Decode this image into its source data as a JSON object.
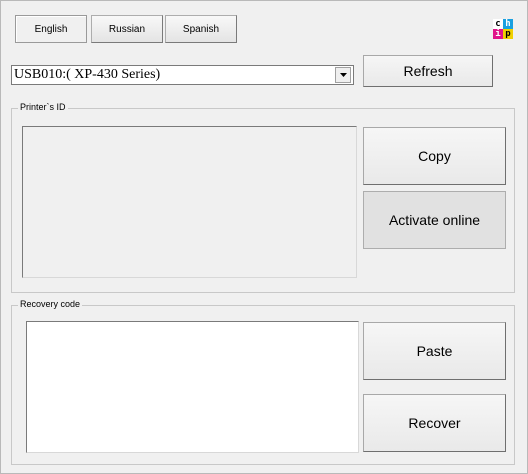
{
  "languages": [
    {
      "label": "English",
      "active": true
    },
    {
      "label": "Russian",
      "active": false
    },
    {
      "label": "Spanish",
      "active": false
    }
  ],
  "logo": {
    "letters": [
      "c",
      "h",
      "i",
      "p"
    ],
    "colors": [
      "#000000",
      "#1aa0e0",
      "#e0148a",
      "#f0d000"
    ]
  },
  "printer_select": {
    "value": "USB010:( XP-430 Series)"
  },
  "buttons": {
    "refresh": "Refresh",
    "copy": "Copy",
    "activate": "Activate online",
    "paste": "Paste",
    "recover": "Recover"
  },
  "printer_id": {
    "label": "Printer`s ID",
    "value": ""
  },
  "recovery": {
    "label": "Recovery code",
    "value": ""
  }
}
